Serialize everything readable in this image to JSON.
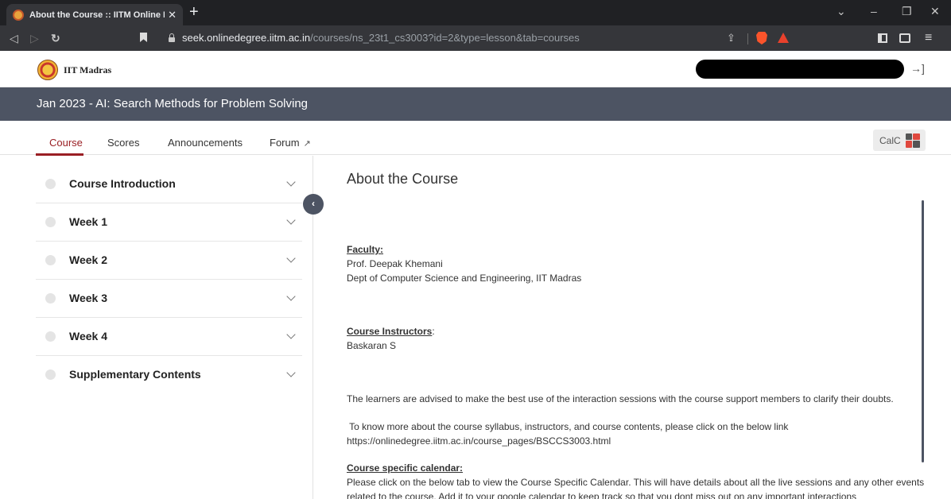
{
  "browser": {
    "tab_title": "About the Course :: IITM Online D",
    "url_host": "seek.onlinedegree.iitm.ac.in",
    "url_path": "/courses/ns_23t1_cs3003?id=2&type=lesson&tab=courses"
  },
  "header": {
    "brand": "IIT Madras",
    "course_title": "Jan 2023 - AI: Search Methods for Problem Solving"
  },
  "tabs": [
    {
      "label": "Course",
      "active": true
    },
    {
      "label": "Scores",
      "active": false
    },
    {
      "label": "Announcements",
      "active": false
    },
    {
      "label": "Forum",
      "active": false
    }
  ],
  "calc_label": "CalC",
  "sidebar": {
    "items": [
      {
        "label": "Course Introduction"
      },
      {
        "label": "Week 1"
      },
      {
        "label": "Week 2"
      },
      {
        "label": "Week 3"
      },
      {
        "label": "Week 4"
      },
      {
        "label": "Supplementary Contents"
      }
    ]
  },
  "content": {
    "title": "About the Course",
    "faculty_heading": "Faculty:",
    "faculty_name": "Prof. Deepak Khemani",
    "faculty_dept": "Dept of Computer Science and Engineering, IIT Madras",
    "instructors_heading": "Course Instructors",
    "instructors_colon": ":",
    "instructor_name": "Baskaran S",
    "advice": "The learners are advised to make the best use of the interaction sessions with the course support members to clarify their doubts.",
    "more_info": " To know more about the course syllabus, instructors, and course contents, please click on the below link",
    "more_info_url": "https://onlinedegree.iitm.ac.in/course_pages/BSCCS3003.html",
    "calendar_heading": "Course specific calendar:",
    "calendar_text_1": "Please click on the below tab to view the Course Specific Calendar. This will have details about all the live sessions and any other events",
    "calendar_text_2": "related to the course. Add it to your google calendar to keep track so that you dont miss out on any important interactions"
  }
}
